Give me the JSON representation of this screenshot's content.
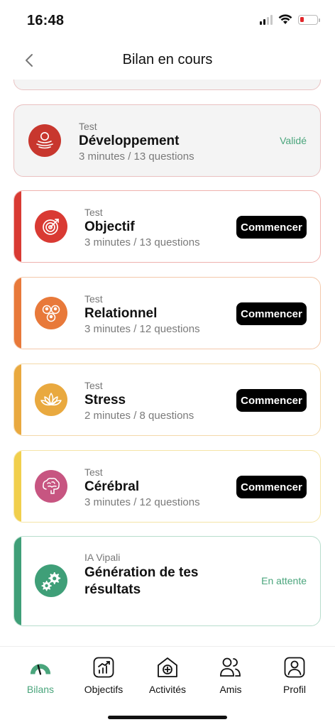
{
  "status_bar": {
    "time": "16:48"
  },
  "header": {
    "title": "Bilan en cours"
  },
  "cards": [
    {
      "label": "Test",
      "title": "Développement",
      "subtitle": "3 minutes / 13 questions",
      "status": "Validé",
      "icon": "development-icon",
      "accent": "#c8372e"
    },
    {
      "label": "Test",
      "title": "Objectif",
      "subtitle": "3 minutes / 13 questions",
      "button": "Commencer",
      "icon": "target-icon",
      "accent": "#d93a33"
    },
    {
      "label": "Test",
      "title": "Relationnel",
      "subtitle": "3 minutes / 12 questions",
      "button": "Commencer",
      "icon": "people-icon",
      "accent": "#e8793a"
    },
    {
      "label": "Test",
      "title": "Stress",
      "subtitle": "2 minutes / 8 questions",
      "button": "Commencer",
      "icon": "lotus-icon",
      "accent": "#e9a93f"
    },
    {
      "label": "Test",
      "title": "Cérébral",
      "subtitle": "3 minutes / 12 questions",
      "button": "Commencer",
      "icon": "brain-icon",
      "accent": "#c75581",
      "stripe": "#f1cf4c"
    },
    {
      "label": "IA Vipali",
      "title_line1": "Génération de tes",
      "title_line2": "résultats",
      "status": "En attente",
      "icon": "gears-icon",
      "accent": "#3f9f78"
    }
  ],
  "tabs": [
    {
      "label": "Bilans",
      "icon": "gauge-icon",
      "active": true
    },
    {
      "label": "Objectifs",
      "icon": "chart-icon"
    },
    {
      "label": "Activités",
      "icon": "house-plus-icon"
    },
    {
      "label": "Amis",
      "icon": "friends-icon"
    },
    {
      "label": "Profil",
      "icon": "profile-icon"
    }
  ],
  "colors": {
    "accent_green": "#4aa57c"
  }
}
